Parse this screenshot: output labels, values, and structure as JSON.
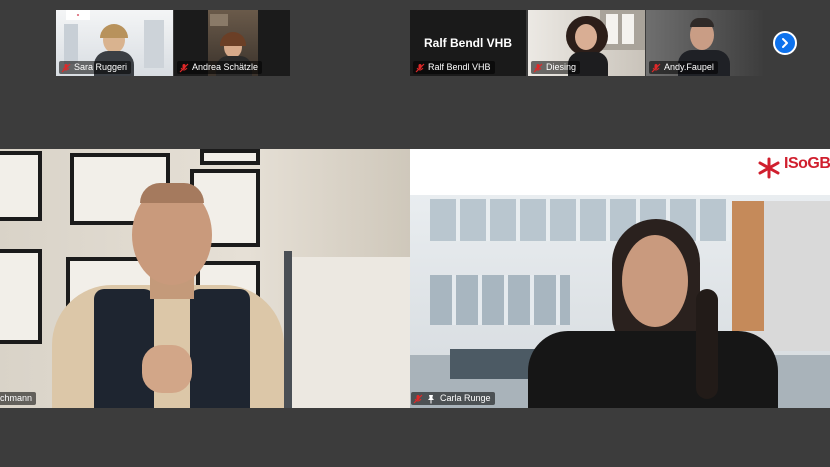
{
  "gallery_strip": {
    "participants": [
      {
        "name": "Sara Ruggeri",
        "muted": true
      },
      {
        "name": "Andrea Schätzle",
        "muted": true
      },
      {
        "name": "Ralf Bendl VHB",
        "muted": true,
        "video_off": true,
        "display_label": "Ralf Bendl VHB"
      },
      {
        "name": "Diesing",
        "muted": true
      },
      {
        "name": "Andy.Faupel",
        "muted": true
      }
    ],
    "next_page_icon": "chevron-right-icon"
  },
  "main_view": {
    "left": {
      "name": "chmann",
      "active_speaker": true
    },
    "right": {
      "name": "Carla Runge",
      "muted": true,
      "pinned": true,
      "logo_text": "ISoGBW"
    }
  },
  "colors": {
    "background": "#3c3c3c",
    "active_speaker_border": "#23d959",
    "mute_icon": "#e02828",
    "next_button": "#0e72ed"
  }
}
